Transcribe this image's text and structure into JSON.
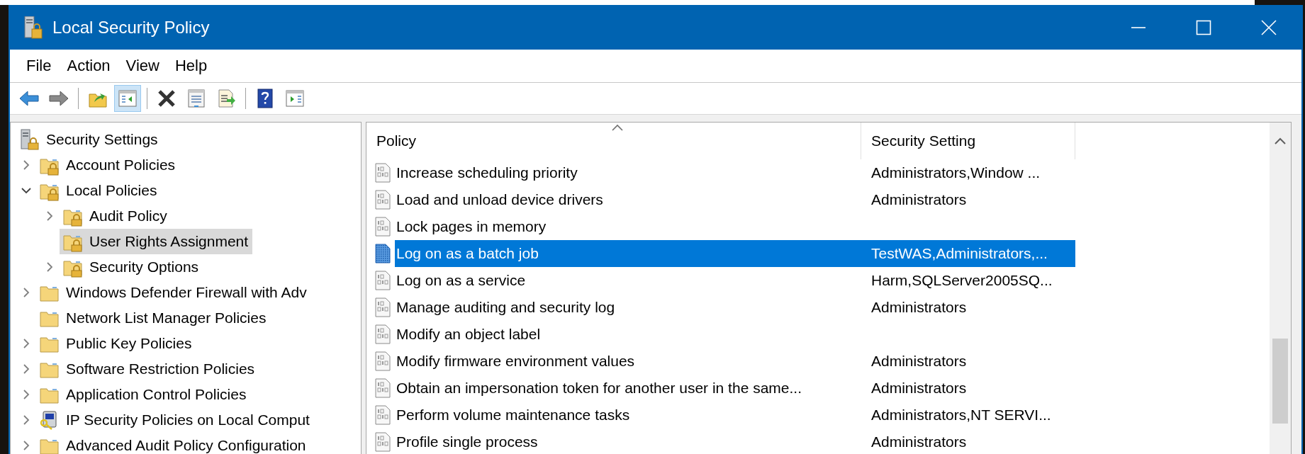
{
  "window": {
    "title": "Local Security Policy"
  },
  "menu": [
    "File",
    "Action",
    "View",
    "Help"
  ],
  "toolbar": [
    {
      "kind": "back",
      "pressed": false
    },
    {
      "kind": "forward",
      "pressed": false
    },
    {
      "kind": "separator"
    },
    {
      "kind": "up",
      "pressed": false
    },
    {
      "kind": "tree",
      "pressed": true
    },
    {
      "kind": "separator"
    },
    {
      "kind": "delete",
      "pressed": false
    },
    {
      "kind": "properties",
      "pressed": false
    },
    {
      "kind": "export",
      "pressed": false
    },
    {
      "kind": "separator"
    },
    {
      "kind": "help",
      "pressed": false
    },
    {
      "kind": "actionpane",
      "pressed": false
    }
  ],
  "tree": [
    {
      "label": "Security Settings",
      "kind": "root",
      "selected": false,
      "children": [
        {
          "label": "Account Policies",
          "kind": "secured",
          "expanded": false,
          "selected": false
        },
        {
          "label": "Local Policies",
          "kind": "secured",
          "expanded": true,
          "selected": false,
          "children": [
            {
              "label": "Audit Policy",
              "kind": "secured",
              "expanded": false,
              "selected": false
            },
            {
              "label": "User Rights Assignment",
              "kind": "secured",
              "selected": true
            },
            {
              "label": "Security Options",
              "kind": "secured",
              "expanded": false,
              "selected": false
            }
          ]
        },
        {
          "label": "Windows Defender Firewall with Adv",
          "kind": "plain",
          "expanded": false,
          "selected": false
        },
        {
          "label": "Network List Manager Policies",
          "kind": "plain",
          "selected": false
        },
        {
          "label": "Public Key Policies",
          "kind": "plain",
          "expanded": false,
          "selected": false
        },
        {
          "label": "Software Restriction Policies",
          "kind": "plain",
          "expanded": false,
          "selected": false
        },
        {
          "label": "Application Control Policies",
          "kind": "plain",
          "expanded": false,
          "selected": false
        },
        {
          "label": "IP Security Policies on Local Comput",
          "kind": "ipsec",
          "expanded": false,
          "selected": false
        },
        {
          "label": "Advanced Audit Policy Configuration",
          "kind": "plain",
          "expanded": false,
          "selected": false
        }
      ]
    }
  ],
  "table": {
    "columns": [
      {
        "label": "Policy",
        "sorted": true
      },
      {
        "label": "Security Setting",
        "sorted": false
      }
    ],
    "rows": [
      {
        "policy": "Increase scheduling priority",
        "setting": "Administrators,Window ...",
        "selected": false
      },
      {
        "policy": "Load and unload device drivers",
        "setting": "Administrators",
        "selected": false
      },
      {
        "policy": "Lock pages in memory",
        "selected": false
      },
      {
        "policy": "Log on as a batch job",
        "setting": "TestWAS,Administrators,...",
        "selected": true
      },
      {
        "policy": "Log on as a service",
        "setting": "Harm,SQLServer2005SQ...",
        "selected": false
      },
      {
        "policy": "Manage auditing and security log",
        "setting": "Administrators",
        "selected": false
      },
      {
        "policy": "Modify an object label",
        "selected": false
      },
      {
        "policy": "Modify firmware environment values",
        "setting": "Administrators",
        "selected": false
      },
      {
        "policy": "Obtain an impersonation token for another user in the same...",
        "setting": "Administrators",
        "selected": false
      },
      {
        "policy": "Perform volume maintenance tasks",
        "setting": "Administrators,NT SERVI...",
        "selected": false
      },
      {
        "policy": "Profile single process",
        "setting": "Administrators",
        "selected": false
      }
    ]
  }
}
